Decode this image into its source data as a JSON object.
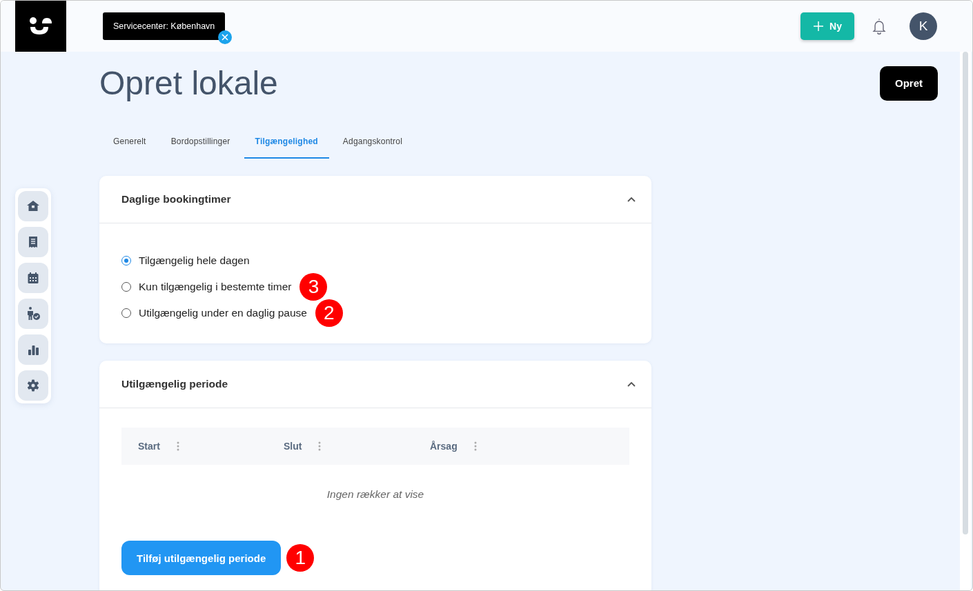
{
  "tooltip": {
    "text": "Servicecenter: København"
  },
  "header": {
    "new_button": "Ny",
    "avatar": "K"
  },
  "page": {
    "title": "Opret lokale",
    "create_button": "Opret"
  },
  "tabs": [
    {
      "label": "Generelt",
      "selected": false
    },
    {
      "label": "Bordopstillinger",
      "selected": false
    },
    {
      "label": "Tilgængelighed",
      "selected": true
    },
    {
      "label": "Adgangskontrol",
      "selected": false
    }
  ],
  "hours_card": {
    "title": "Daglige bookingtimer",
    "expanded": true,
    "options": [
      {
        "label": "Tilgængelig hele dagen",
        "selected": true
      },
      {
        "label": "Kun tilgængelig i bestemte timer",
        "selected": false,
        "marker": "3"
      },
      {
        "label": "Utilgængelig under en daglig pause",
        "selected": false,
        "marker": "2"
      }
    ]
  },
  "period_card": {
    "title": "Utilgængelig periode",
    "expanded": true,
    "columns": [
      "Start",
      "Slut",
      "Årsag"
    ],
    "empty_text": "Ingen rækker at vise",
    "add_button": "Tilføj utilgængelig periode",
    "add_marker": "1"
  }
}
